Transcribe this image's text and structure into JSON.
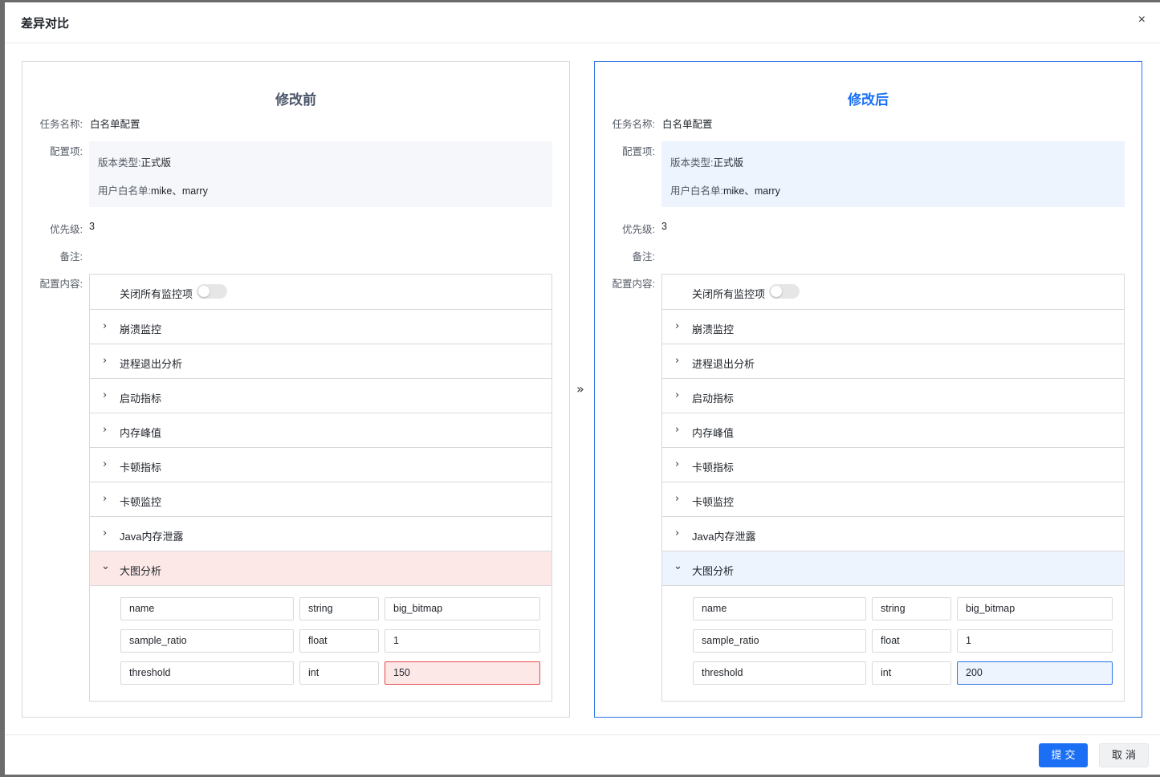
{
  "modal": {
    "title": "差异对比",
    "close_icon": "×"
  },
  "icons": {
    "chevron_right": "›",
    "chevron_down": "⌄",
    "double_arrow": "»"
  },
  "labels": {
    "task_name": "任务名称:",
    "config_items": "配置项:",
    "version_type": "版本类型:",
    "user_whitelist": "用户白名单:",
    "priority": "优先级:",
    "remark": "备注:",
    "config_content": "配置内容:",
    "close_all_monitors": "关闭所有监控项"
  },
  "categories": [
    "崩溃监控",
    "进程退出分析",
    "启动指标",
    "内存峰值",
    "卡顿指标",
    "卡顿监控",
    "Java内存泄露",
    "大图分析"
  ],
  "before": {
    "title": "修改前",
    "task_name": "白名单配置",
    "version_type": "正式版",
    "user_whitelist": "mike、marry",
    "priority": "3",
    "remark": "",
    "params": [
      {
        "name": "name",
        "type": "string",
        "value": "big_bitmap"
      },
      {
        "name": "sample_ratio",
        "type": "float",
        "value": "1"
      },
      {
        "name": "threshold",
        "type": "int",
        "value": "150"
      }
    ]
  },
  "after": {
    "title": "修改后",
    "task_name": "白名单配置",
    "version_type": "正式版",
    "user_whitelist": "mike、marry",
    "priority": "3",
    "remark": "",
    "params": [
      {
        "name": "name",
        "type": "string",
        "value": "big_bitmap"
      },
      {
        "name": "sample_ratio",
        "type": "float",
        "value": "1"
      },
      {
        "name": "threshold",
        "type": "int",
        "value": "200"
      }
    ]
  },
  "footer": {
    "submit": "提交",
    "cancel": "取消"
  },
  "colors": {
    "primary": "#1a6ff5",
    "diff_removed_bg": "#fde8e8",
    "diff_removed_border": "#e84a4a",
    "diff_added_bg": "#edf4fe"
  }
}
